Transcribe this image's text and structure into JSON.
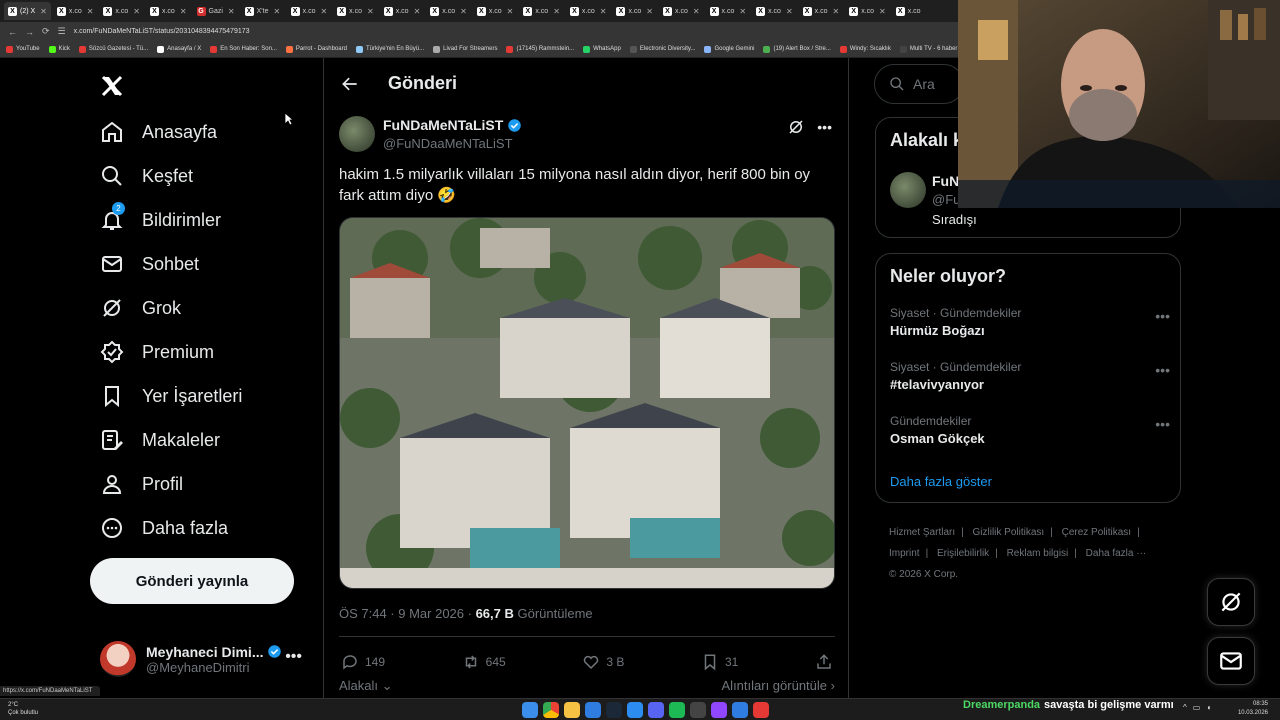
{
  "browser": {
    "tabs": [
      "(2) X",
      "x.co",
      "x.co",
      "x.co",
      "Gazi",
      "X'te",
      "x.co",
      "x.co",
      "x.co",
      "x.co",
      "x.co",
      "x.co",
      "x.co",
      "x.co",
      "x.co",
      "x.co",
      "x.co",
      "x.co",
      "x.co",
      "x.co"
    ],
    "url": "x.com/FuNDaMeNTaLiST/status/2031048394475479173",
    "bookmarks": [
      "YouTube",
      "Kick",
      "Sözcü Gazetesi - Tü...",
      "Anasayfa / X",
      "En Son Haber: Son...",
      "Parrot - Dashboard",
      "Türkiye'nin En Büyü...",
      "Livad For Streamers",
      "(17145) Rammstein...",
      "WhatsApp",
      "Electronic Diversity...",
      "Google Gemini",
      "(19) Alert Box / Stre...",
      "Windy: Sıcaklık",
      "Multi TV - 6 haber"
    ]
  },
  "nav": {
    "items": [
      {
        "label": "Anasayfa"
      },
      {
        "label": "Keşfet"
      },
      {
        "label": "Bildirimler",
        "badge": "2"
      },
      {
        "label": "Sohbet"
      },
      {
        "label": "Grok"
      },
      {
        "label": "Premium"
      },
      {
        "label": "Yer İşaretleri"
      },
      {
        "label": "Makaleler"
      },
      {
        "label": "Profil"
      },
      {
        "label": "Daha fazla"
      }
    ],
    "post_button": "Gönderi yayınla",
    "account": {
      "name": "Meyhaneci Dimi...",
      "handle": "@MeyhaneDimitri"
    }
  },
  "main": {
    "title": "Gönderi",
    "author": {
      "name": "FuNDaMeNTaLiST",
      "handle": "@FuNDaaMeNTaLiST"
    },
    "text": "hakim 1.5 milyarlık villaları 15 milyona nasıl aldın diyor, herif 800 bin oy fark attım diyo 🤣",
    "time": "ÖS 7:44 · 9 Mar 2026 · ",
    "views_count": "66,7 B",
    "views_label": "Görüntüleme",
    "stats": {
      "replies": "149",
      "reposts": "645",
      "likes": "3 B",
      "bookmarks": "31"
    },
    "relevant_label": "Alakalı",
    "quotes_label": "Alıntıları görüntüle"
  },
  "right": {
    "search_placeholder": "Ara",
    "related": {
      "title": "Alakalı k",
      "name": "FuNI",
      "handle": "@Fu",
      "bio": "Sıradışı"
    },
    "trends": {
      "title": "Neler oluyor?",
      "items": [
        {
          "category": "Siyaset · Gündemdekiler",
          "name": "Hürmüz Boğazı"
        },
        {
          "category": "Siyaset · Gündemdekiler",
          "name": "#telavivyanıyor"
        },
        {
          "category": "Gündemdekiler",
          "name": "Osman Gökçek"
        }
      ],
      "show_more": "Daha fazla göster"
    },
    "footer": [
      "Hizmet Şartları",
      "Gizlilik Politikası",
      "Çerez Politikası",
      "Imprint",
      "Erişilebilirlik",
      "Reklam bilgisi",
      "Daha fazla ···",
      "© 2026 X Corp."
    ]
  },
  "status_link": "https://x.com/FuNDaaMeNTaLiST",
  "taskbar": {
    "weather_temp": "2°C",
    "weather_desc": "Çok bulutlu",
    "chat_user": "Dreamerpanda",
    "chat_message": "savaşta bi gelişme varmı",
    "time": "08:35",
    "date": "10.03.2026"
  },
  "colors": {
    "accent": "#1d9bf0",
    "bg": "#000000",
    "muted": "#71767b",
    "text": "#e7e9ea"
  }
}
